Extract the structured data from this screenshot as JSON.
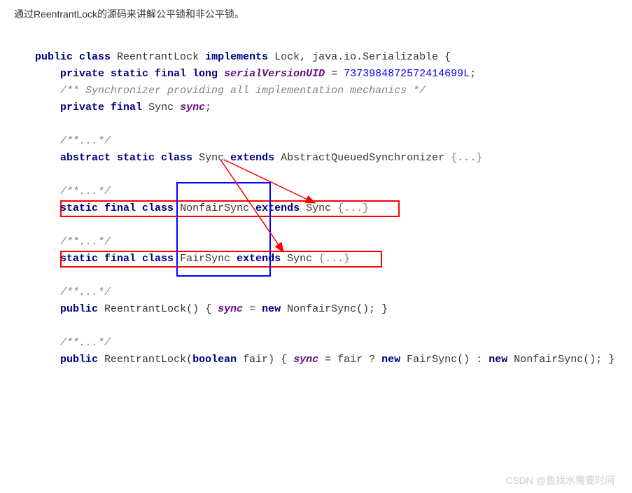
{
  "intro": "通过ReentrantLock的源码来讲解公平锁和非公平锁。",
  "code": {
    "l1_kw1": "public class",
    "l1_cls": "ReentrantLock",
    "l1_kw2": "implements",
    "l1_impl": "Lock, java.io.Serializable {",
    "l2_kw": "private static final long",
    "l2_field": "serialVersionUID",
    "l2_eq": " = ",
    "l2_num": "7373984872572414699L",
    "l2_semi": ";",
    "l3_comment": "/** Synchronizer providing all implementation mechanics */",
    "l4_kw": "private final",
    "l4_type": "Sync",
    "l4_field": "sync",
    "l4_semi": ";",
    "l5_comment": "/**...*/",
    "l6_kw": "abstract static class",
    "l6_cls": "Sync",
    "l6_ext": "extends",
    "l6_sup": "AbstractQueuedSynchronizer",
    "l6_fold": "{...}",
    "l7_comment": "/**...*/",
    "l8_kw": "static final class",
    "l8_cls": "NonfairSync",
    "l8_ext": "extends",
    "l8_sup": "Sync",
    "l8_fold": "{...}",
    "l9_comment": "/**...*/",
    "l10_kw": "static final class",
    "l10_cls": "FairSync",
    "l10_ext": "extends",
    "l10_sup": "Sync",
    "l10_fold": "{...}",
    "l11_comment": "/**...*/",
    "l12_kw1": "public",
    "l12_name": "ReentrantLock()",
    "l12_brace1": " { ",
    "l12_field": "sync",
    "l12_eq": " = ",
    "l12_kw2": "new",
    "l12_call": " NonfairSync(); }",
    "l13_comment": "/**...*/",
    "l14_kw1": "public",
    "l14_name": "ReentrantLock(",
    "l14_kw2": "boolean",
    "l14_param": " fair)",
    "l14_brace1": " { ",
    "l14_field": "sync",
    "l14_eq": " = fair ? ",
    "l14_kw3": "new",
    "l14_fs": " FairSync() : ",
    "l14_kw4": "new",
    "l14_ns": " NonfairSync(); }"
  },
  "watermark": "CSDN @鱼找水需要时间"
}
